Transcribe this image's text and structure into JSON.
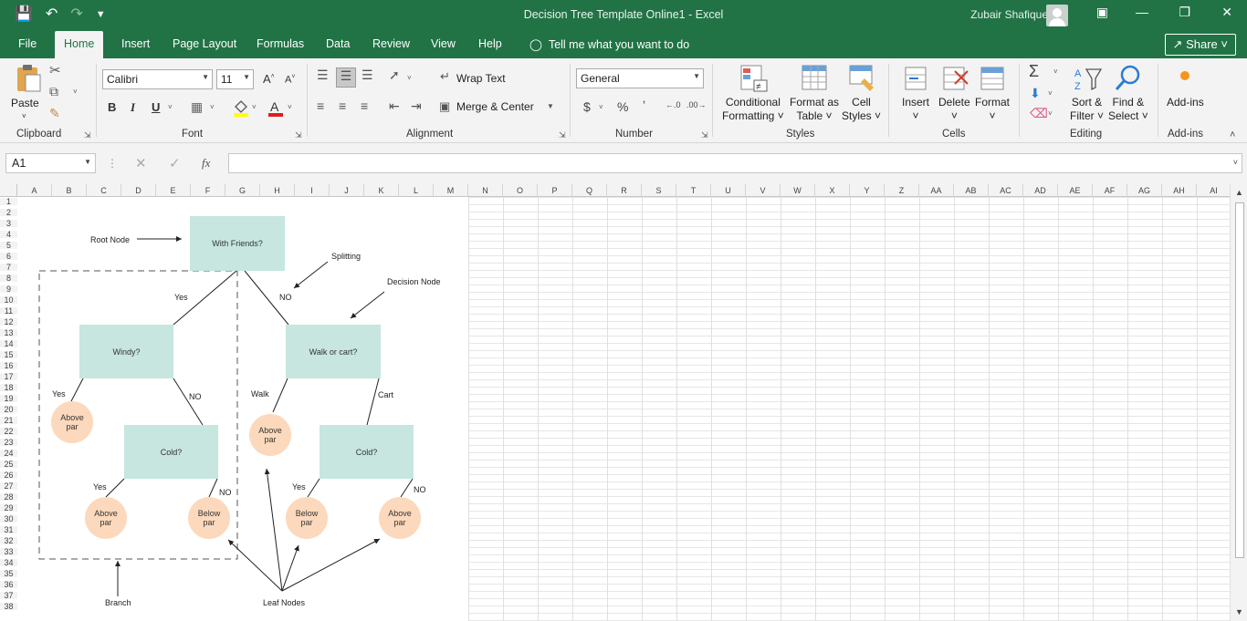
{
  "window": {
    "doc_title": "Decision Tree Template Online1  -  Excel",
    "user": "Zubair Shafique"
  },
  "tabs": [
    "File",
    "Home",
    "Insert",
    "Page Layout",
    "Formulas",
    "Data",
    "Review",
    "View",
    "Help"
  ],
  "active_tab": "Home",
  "tell_me": "Tell me what you want to do",
  "share": "Share",
  "ribbon": {
    "clipboard": {
      "paste": "Paste",
      "label": "Clipboard"
    },
    "font": {
      "name": "Calibri",
      "size": "11",
      "label": "Font"
    },
    "alignment": {
      "wrap": "Wrap Text",
      "merge": "Merge & Center",
      "label": "Alignment"
    },
    "number": {
      "format": "General",
      "label": "Number"
    },
    "styles": {
      "cond1": "Conditional",
      "cond2": "Formatting",
      "fmt1": "Format as",
      "fmt2": "Table",
      "cell1": "Cell",
      "cell2": "Styles",
      "label": "Styles"
    },
    "cells": {
      "insert": "Insert",
      "delete": "Delete",
      "format": "Format",
      "label": "Cells"
    },
    "editing": {
      "sort1": "Sort &",
      "sort2": "Filter",
      "find1": "Find &",
      "find2": "Select",
      "label": "Editing"
    },
    "addins": {
      "btn": "Add-ins",
      "label": "Add-ins"
    }
  },
  "formula_bar": {
    "name_box": "A1",
    "fx": "fx",
    "value": ""
  },
  "columns": [
    "A",
    "B",
    "C",
    "D",
    "E",
    "F",
    "G",
    "H",
    "I",
    "J",
    "K",
    "L",
    "M",
    "N",
    "O",
    "P",
    "Q",
    "R",
    "S",
    "T",
    "U",
    "V",
    "W",
    "X",
    "Y",
    "Z",
    "AA",
    "AB",
    "AC",
    "AD",
    "AE",
    "AF",
    "AG",
    "AH",
    "AI"
  ],
  "rows": [
    "1",
    "2",
    "3",
    "4",
    "5",
    "6",
    "7",
    "8",
    "9",
    "10",
    "11",
    "12",
    "13",
    "14",
    "15",
    "16",
    "17",
    "18",
    "19",
    "20",
    "21",
    "22",
    "23",
    "24",
    "25",
    "26",
    "27",
    "28",
    "29",
    "30",
    "31",
    "32",
    "33",
    "34",
    "35",
    "36",
    "37",
    "38"
  ],
  "diagram": {
    "root": "With Friends?",
    "windy": "Windy?",
    "walk": "Walk or cart?",
    "cold_left": "Cold?",
    "cold_right": "Cold?",
    "leaf1": [
      "Above",
      "par"
    ],
    "leaf2": [
      "Above",
      "par"
    ],
    "leaf3": [
      "Below",
      "par"
    ],
    "leaf4": [
      "Above",
      "par"
    ],
    "leaf5": [
      "Below",
      "par"
    ],
    "leaf6": [
      "Above",
      "par"
    ],
    "lbl_root_node": "Root Node",
    "lbl_splitting": "Splitting",
    "lbl_decision_node": "Decision Node",
    "lbl_branch": "Branch",
    "lbl_leaf_nodes": "Leaf Nodes",
    "yes": "Yes",
    "no": "NO",
    "walk_lbl": "Walk",
    "cart_lbl": "Cart"
  }
}
